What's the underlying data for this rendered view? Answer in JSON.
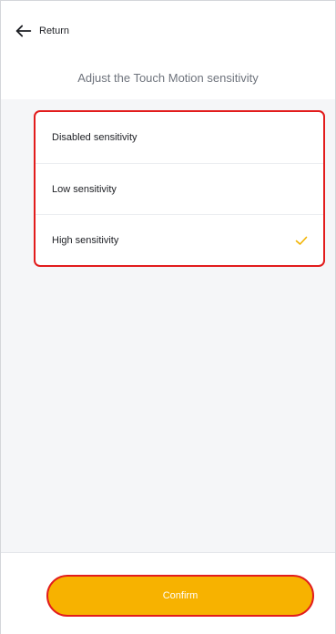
{
  "header": {
    "back_label": "Return",
    "back_icon": "arrow-left-icon",
    "title": "Adjust the Touch Motion sensitivity"
  },
  "options": [
    {
      "label": "Disabled sensitivity",
      "selected": false
    },
    {
      "label": "Low sensitivity",
      "selected": false
    },
    {
      "label": "High sensitivity",
      "selected": true
    }
  ],
  "selected_icon": "checkmark-icon",
  "footer": {
    "confirm_label": "Confirm"
  },
  "colors": {
    "accent": "#f7b200",
    "highlight_outline": "#e21c1c",
    "check": "#f2b300"
  }
}
